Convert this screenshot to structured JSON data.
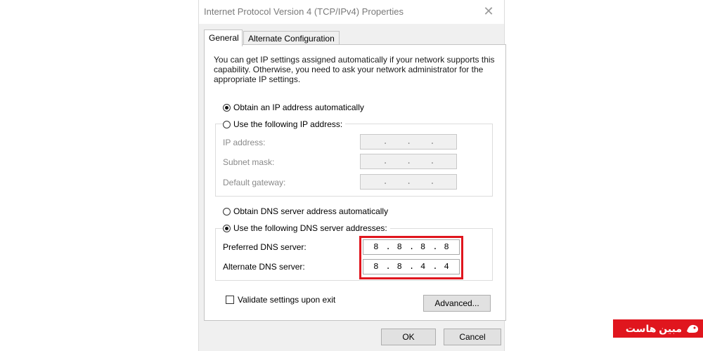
{
  "window": {
    "title": "Internet Protocol Version 4 (TCP/IPv4) Properties",
    "close_glyph": "✕"
  },
  "tabs": [
    {
      "label": "General",
      "active": true
    },
    {
      "label": "Alternate Configuration",
      "active": false
    }
  ],
  "general": {
    "description": "You can get IP settings assigned automatically if your network supports this capability. Otherwise, you need to ask your network administrator for the appropriate IP settings.",
    "ip_mode": {
      "auto_label": "Obtain an IP address automatically",
      "manual_label": "Use the following IP address:",
      "selected": "auto"
    },
    "ip_fields": [
      {
        "label": "IP address:",
        "value": ". . ."
      },
      {
        "label": "Subnet mask:",
        "value": ". . ."
      },
      {
        "label": "Default gateway:",
        "value": ". . ."
      }
    ],
    "dns_mode": {
      "auto_label": "Obtain DNS server address automatically",
      "manual_label": "Use the following DNS server addresses:",
      "selected": "manual"
    },
    "dns_fields": [
      {
        "label": "Preferred DNS server:",
        "octets": [
          "8",
          "8",
          "8",
          "8"
        ]
      },
      {
        "label": "Alternate DNS server:",
        "octets": [
          "8",
          "8",
          "4",
          "4"
        ]
      }
    ],
    "validate_label": "Validate settings upon exit",
    "validate_checked": false,
    "advanced_label": "Advanced..."
  },
  "footer": {
    "ok_label": "OK",
    "cancel_label": "Cancel"
  },
  "watermark": {
    "text": "مبین هاست"
  },
  "colors": {
    "highlight": "#e0161e",
    "dialog_bg": "#f0f0f0"
  }
}
